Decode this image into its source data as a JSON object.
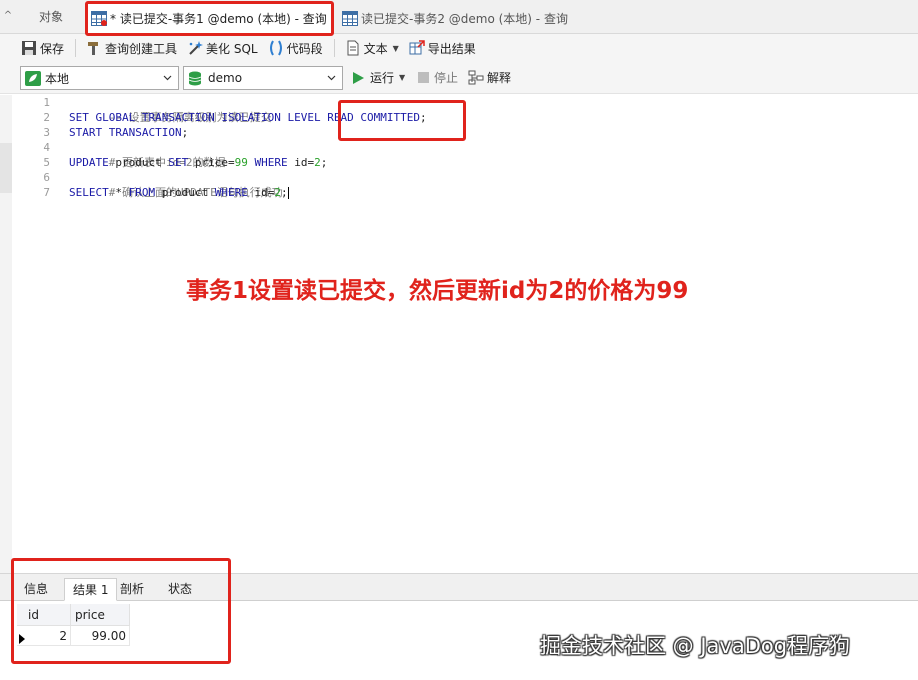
{
  "tabs": {
    "objects_label": "对象",
    "active_label": "* 读已提交-事务1 @demo (本地) - 查询",
    "inactive_label": "读已提交-事务2 @demo (本地) - 查询"
  },
  "toolbar": {
    "save": "保存",
    "query_builder": "查询创建工具",
    "beautify_sql": "美化 SQL",
    "code_snippet": "代码段",
    "text": "文本",
    "export_results": "导出结果"
  },
  "connection": {
    "selected": "本地",
    "database": "demo",
    "run": "运行",
    "stop": "停止",
    "explain": "解释"
  },
  "editor": {
    "line_numbers": [
      "1",
      "2",
      "3",
      "4",
      "5",
      "6",
      "7"
    ],
    "lines": {
      "l1": "-- 设置事务隔离级别为读已提交",
      "l2_kw": "SET GLOBAL TRANSACTION ISOLATION LEVEL READ COMMITTED",
      "l2_end": ";",
      "l3_kw": "START TRANSACTION",
      "l3_end": ";",
      "l4": "# 更新表中id=2的数据",
      "l5_kw1": "UPDATE",
      "l5_t1": " product ",
      "l5_kw2": "SET",
      "l5_t2": " price=",
      "l5_num1": "99",
      "l5_kw3": " WHERE",
      "l5_t3": " id=",
      "l5_num2": "2",
      "l5_end": ";",
      "l6": "# 确认上面的UPDATE语句执行成功",
      "l7_kw1": "SELECT",
      "l7_t1": " * ",
      "l7_kw2": "FROM",
      "l7_t2": " product ",
      "l7_kw3": "WHERE",
      "l7_t3": " id=",
      "l7_num": "2",
      "l7_end": ";"
    }
  },
  "annotation": "事务1设置读已提交，然后更新id为2的价格为99",
  "results": {
    "tabs": [
      "信息",
      "结果 1",
      "剖析",
      "状态"
    ],
    "active_tab": "结果 1",
    "columns": [
      "id",
      "price"
    ],
    "rows": [
      [
        "2",
        "99.00"
      ]
    ]
  },
  "watermark": "掘金技术社区 @ JavaDog程序狗",
  "colors": {
    "highlight": "#e0231c",
    "keyword": "#1a1aa6",
    "comment": "#808080",
    "number": "#2aa12a"
  }
}
